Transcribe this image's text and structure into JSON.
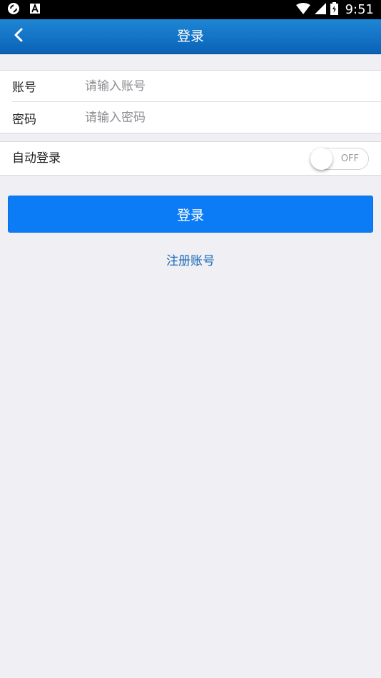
{
  "status_bar": {
    "time": "9:51",
    "left_icons": [
      "sync-icon",
      "notification-a-icon"
    ],
    "right_icons": [
      "wifi-icon",
      "signal-icon",
      "battery-icon"
    ]
  },
  "nav": {
    "title": "登录",
    "back_icon": "chevron-left-icon"
  },
  "form": {
    "account_label": "账号",
    "account_placeholder": "请输入账号",
    "account_value": "",
    "password_label": "密码",
    "password_placeholder": "请输入密码",
    "password_value": ""
  },
  "auto_login": {
    "label": "自动登录",
    "toggle_text": "OFF",
    "enabled": false
  },
  "actions": {
    "login_label": "登录",
    "register_label": "注册账号"
  },
  "colors": {
    "nav_bar": "#1778c8",
    "primary_button": "#0b7cf6",
    "link": "#1a67b5",
    "background": "#efeff4"
  }
}
